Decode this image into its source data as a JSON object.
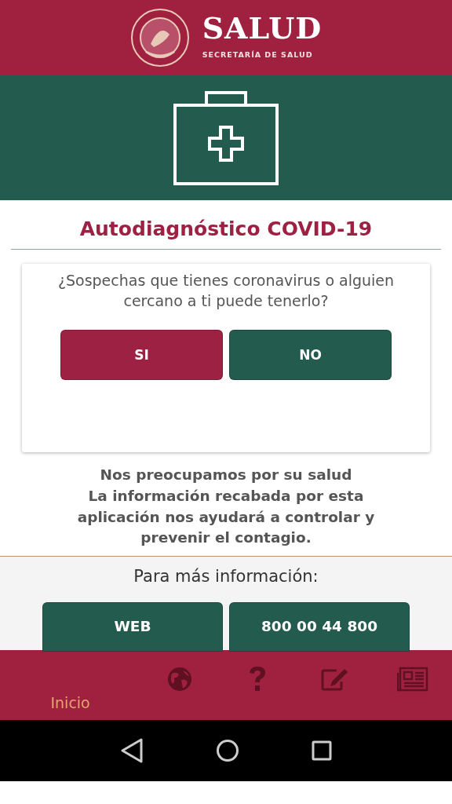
{
  "header": {
    "title": "SALUD",
    "subtitle": "SECRETARÍA DE SALUD"
  },
  "title": "Autodiagnóstico COVID-19",
  "question": {
    "text": "¿Sospechas que tienes coronavirus o alguien cercano a ti puede tenerlo?",
    "answers": [
      {
        "label": "SI",
        "kind": "yes"
      },
      {
        "label": "NO",
        "kind": "no"
      }
    ]
  },
  "message": [
    "Nos preocupamos por su salud",
    "La información recabada por esta aplicación nos ayudará a controlar y prevenir el contagio."
  ],
  "info": {
    "label": "Para más información:",
    "buttons": [
      "WEB",
      "800 00 44 800"
    ]
  },
  "bottom_nav": [
    {
      "kind": "home",
      "label": "Inicio",
      "selected": true
    },
    {
      "kind": "globe",
      "selected": false
    },
    {
      "kind": "help",
      "selected": false
    },
    {
      "kind": "edit",
      "selected": false
    },
    {
      "kind": "news",
      "selected": false
    }
  ]
}
